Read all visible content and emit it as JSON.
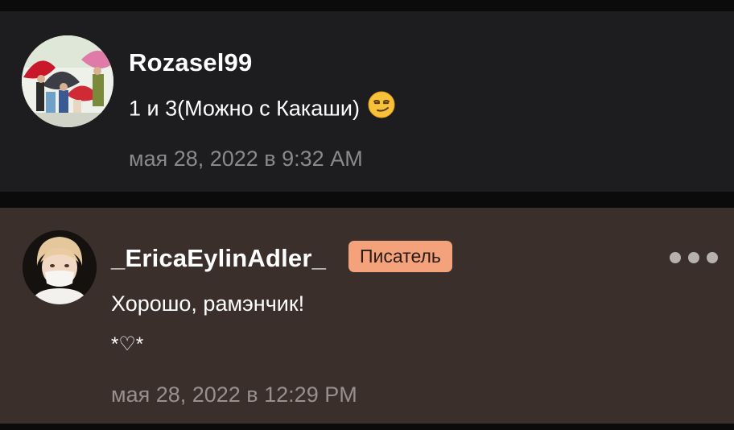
{
  "comments": [
    {
      "username": "Rozasel99",
      "text": "1 и 3(Можно с Какаши)",
      "emoji_icon": "smirking-face-emoji",
      "timestamp": "мая 28, 2022 в 9:32 AM"
    },
    {
      "username": "_EricaEylinAdler_",
      "badge": "Писатель",
      "text": "Хорошо, рамэнчик!",
      "text_line2": "*♡*",
      "timestamp": "мая 28, 2022 в 12:29 PM",
      "more_icon": "more-options-icon"
    }
  ],
  "colors": {
    "card_1_bg": "#1d1c1e",
    "card_2_bg": "#3b2f2c",
    "badge_bg": "#f4a27b",
    "timestamp": "#8e8c8e"
  }
}
